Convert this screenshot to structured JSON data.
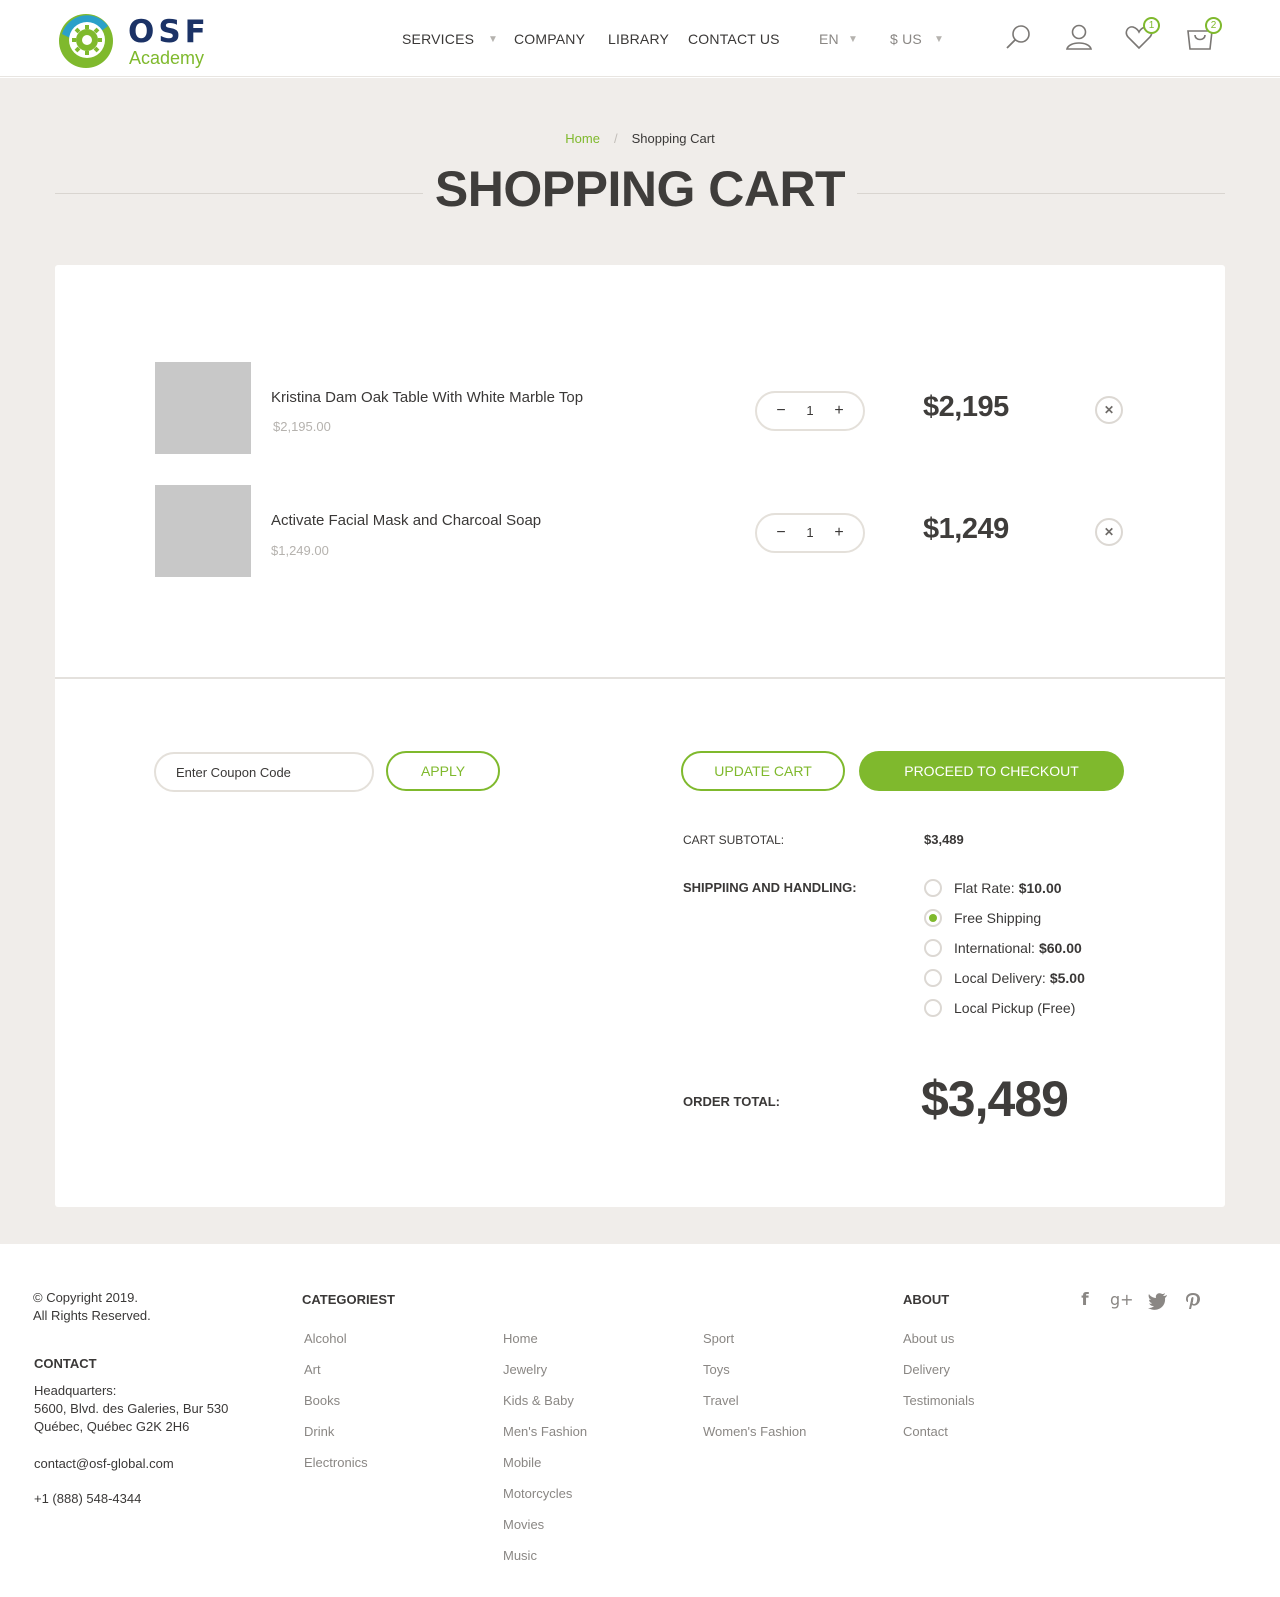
{
  "brand": {
    "name": "OSF",
    "tagline": "Academy",
    "green": "#7fb92d",
    "navy": "#1b3266"
  },
  "nav": {
    "items": [
      "SERVICES",
      "COMPANY",
      "LIBRARY",
      "CONTACT US"
    ],
    "language": "EN",
    "currency": "$ US",
    "wishlist_count": "1",
    "cart_count": "2",
    "icons": [
      "search-icon",
      "user-icon",
      "heart-icon",
      "bag-icon"
    ]
  },
  "breadcrumb": {
    "home": "Home",
    "separator": "/",
    "current": "Shopping Cart"
  },
  "page_title": "SHOPPING CART",
  "cart": {
    "items": [
      {
        "name": "Kristina Dam Oak Table With White Marble Top",
        "unit_price": "$2,195.00",
        "quantity": "1",
        "total": "$2,195"
      },
      {
        "name": "Activate Facial Mask and Charcoal Soap",
        "unit_price": "$1,249.00",
        "quantity": "1",
        "total": "$1,249"
      }
    ],
    "coupon_placeholder": "Enter Coupon Code",
    "apply_label": "APPLY",
    "update_label": "UPDATE CART",
    "checkout_label": "PROCEED TO CHECKOUT",
    "subtotal_label": "CART SUBTOTAL:",
    "subtotal_value": "$3,489",
    "shipping_label": "SHIPPIING AND HANDLING:",
    "shipping_options": [
      {
        "label": "Flat Rate:",
        "price": "$10.00",
        "selected": false
      },
      {
        "label": "Free Shipping",
        "price": "",
        "selected": true
      },
      {
        "label": "International:",
        "price": "$60.00",
        "selected": false
      },
      {
        "label": "Local Delivery:",
        "price": "$5.00",
        "selected": false
      },
      {
        "label": "Local Pickup (Free)",
        "price": "",
        "selected": false
      }
    ],
    "order_total_label": "ORDER TOTAL:",
    "order_total_value": "$3,489"
  },
  "footer": {
    "copyright_line1": "© Copyright 2019.",
    "copyright_line2": "All Rights Reserved.",
    "contact_heading": "CONTACT",
    "hq_label": "Headquarters:",
    "address_line1": "5600, Blvd. des Galeries, Bur 530",
    "address_line2": "Québec, Québec G2K 2H6",
    "email": "contact@osf-global.com",
    "phone": "+1 (888) 548-4344",
    "categories_heading": "CATEGORIEST",
    "categories_col1": [
      "Alcohol",
      "Art",
      "Books",
      "Drink",
      "Electronics"
    ],
    "categories_col2": [
      "Home",
      "Jewelry",
      "Kids & Baby",
      "Men's Fashion",
      "Mobile",
      "Motorcycles",
      "Movies",
      "Music"
    ],
    "categories_col3": [
      "Sport",
      "Toys",
      "Travel",
      "Women's Fashion"
    ],
    "about_heading": "ABOUT",
    "about_links": [
      "About us",
      "Delivery",
      "Testimonials",
      "Contact"
    ],
    "social": [
      "facebook-icon",
      "google-plus-icon",
      "twitter-icon",
      "pinterest-icon"
    ]
  }
}
